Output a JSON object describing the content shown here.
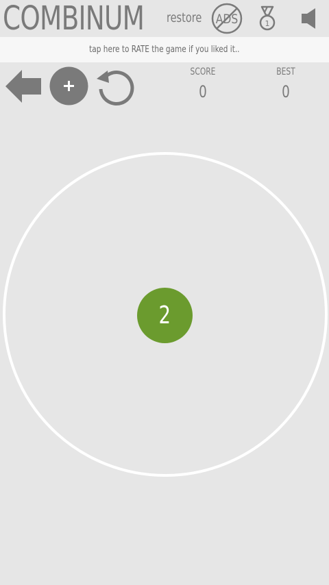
{
  "header": {
    "title": "COMBINUM",
    "restore_label": "restore",
    "ads_icon_text": "ADS"
  },
  "banner": {
    "text": "tap here to RATE the game if you liked it.."
  },
  "controls": {
    "back_icon": "arrow-left-icon",
    "add_icon": "plus-circle-icon",
    "restart_icon": "restart-icon"
  },
  "stats": {
    "score_label": "SCORE",
    "score_value": "0",
    "best_label": "BEST",
    "best_value": "0"
  },
  "game": {
    "ball_value": "2"
  },
  "medal_number": "1",
  "colors": {
    "background": "#e6e6e6",
    "banner": "#f7f7f7",
    "icon_gray": "#7a7a7a",
    "ring": "#ffffff",
    "ball_green": "#6b9b2e"
  }
}
